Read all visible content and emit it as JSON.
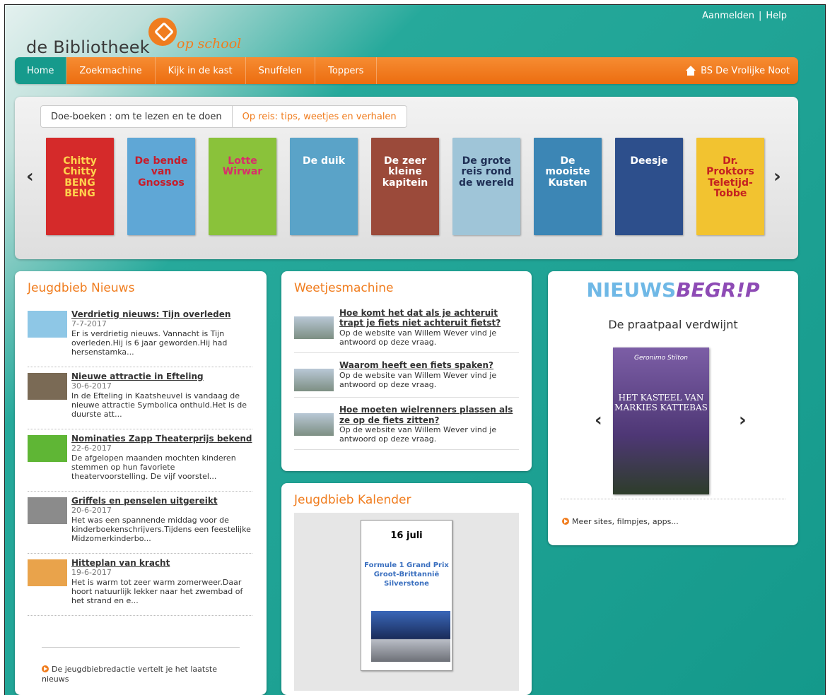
{
  "header": {
    "login": "Aanmelden",
    "help": "Help",
    "logo_word": "de Bibliotheek",
    "logo_script": "op school"
  },
  "nav": {
    "items": [
      {
        "label": "Home"
      },
      {
        "label": "Zoekmachine"
      },
      {
        "label": "Kijk in de kast"
      },
      {
        "label": "Snuffelen"
      },
      {
        "label": "Toppers"
      }
    ],
    "school": "BS De Vrolijke Noot"
  },
  "carousel": {
    "tabs": [
      "Doe-boeken : om te lezen en te doen",
      "Op reis: tips, weetjes en verhalen"
    ],
    "books": [
      {
        "title": "Chitty Chitty BENG BENG",
        "bg": "#d52a2a",
        "fg": "#ffd34d"
      },
      {
        "title": "De bende van Gnossos",
        "bg": "#5fa7d6",
        "fg": "#c71d2b"
      },
      {
        "title": "Lotte Wirwar",
        "bg": "#8ac23a",
        "fg": "#d92d6b"
      },
      {
        "title": "De duik",
        "bg": "#5aa3c8",
        "fg": "#ffffff"
      },
      {
        "title": "De zeer kleine kapitein",
        "bg": "#9b4a3a",
        "fg": "#ffffff"
      },
      {
        "title": "De grote reis rond de wereld",
        "bg": "#9fc5d8",
        "fg": "#1f2f55"
      },
      {
        "title": "De mooiste Kusten",
        "bg": "#3c86b5",
        "fg": "#ffffff"
      },
      {
        "title": "Deesje",
        "bg": "#2d4f8c",
        "fg": "#ffffff"
      },
      {
        "title": "Dr. Proktors Teletijd-Tobbe",
        "bg": "#f2c330",
        "fg": "#c42020"
      }
    ]
  },
  "news": {
    "heading": "Jeugdbieb Nieuws",
    "items": [
      {
        "title": "Verdrietig nieuws: Tijn overleden",
        "date": "7-7-2017",
        "text": "Er is verdrietig nieuws. Vannacht is Tijn overleden.Hij is 6 jaar geworden.Hij had hersenstamka..."
      },
      {
        "title": "Nieuwe attractie in Efteling",
        "date": "30-6-2017",
        "text": "In de Efteling in Kaatsheuvel is vandaag de nieuwe attractie Symbolica onthuld.Het is de duurste att..."
      },
      {
        "title": "Nominaties Zapp Theaterprijs bekend",
        "date": "22-6-2017",
        "text": "De afgelopen maanden mochten kinderen stemmen op hun favoriete theatervoorstelling. De vijf voorstel..."
      },
      {
        "title": "Griffels en penselen uitgereikt",
        "date": "20-6-2017",
        "text": "Het was een spannende middag voor de kinderboekenschrijvers.Tijdens een feestelijke Midzomerkinderbo..."
      },
      {
        "title": "Hitteplan van kracht",
        "date": "19-6-2017",
        "text": "Het is warm tot zeer warm zomerweer.Daar hoort natuurlijk lekker naar het zwembad of het strand en e..."
      }
    ],
    "footer": "De jeugdbiebredactie vertelt je het laatste nieuws"
  },
  "weetjes": {
    "heading": "Weetjesmachine",
    "items": [
      {
        "title": "Hoe komt het dat als je achteruit trapt je fiets niet achteruit fietst?",
        "text": "Op de website van Willem Wever vind je antwoord op deze vraag."
      },
      {
        "title": "Waarom heeft een fiets spaken?",
        "text": "Op de website van Willem Wever vind je antwoord op deze vraag."
      },
      {
        "title": "Hoe moeten wielrenners plassen als ze op de fiets zitten?",
        "text": "Op de website van Willem Wever vind je antwoord op deze vraag."
      }
    ]
  },
  "kalender": {
    "heading": "Jeugdbieb Kalender",
    "date": "16 juli",
    "event": "Formule 1 Grand Prix Groot-Brittannië Silverstone"
  },
  "nieuwsbegrip": {
    "logo_a": "NIEUWS",
    "logo_b": "BEGR!P",
    "subtitle": "De praatpaal verdwijnt",
    "book_author": "Geronimo Stilton",
    "book_title": "HET KASTEEL VAN MARKIES KATTEBAS",
    "more": "Meer sites, filmpjes, apps..."
  }
}
